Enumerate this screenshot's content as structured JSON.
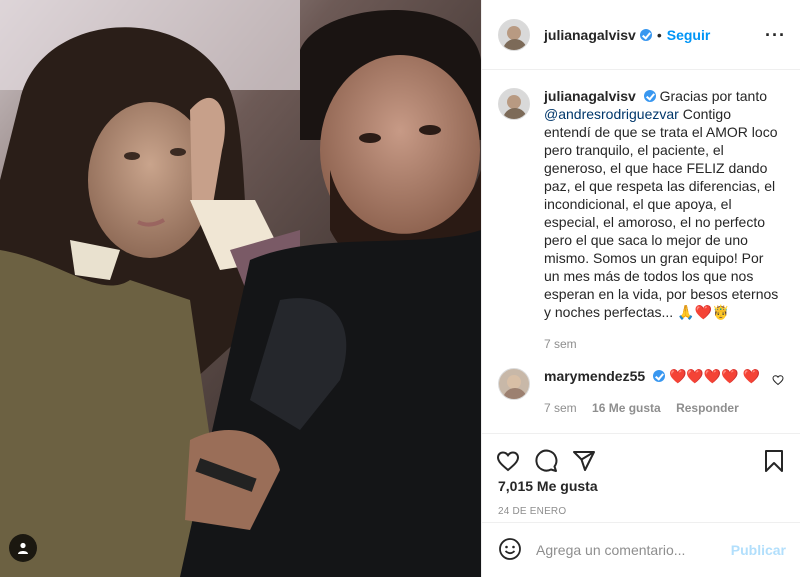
{
  "post": {
    "author": "julianagalvisv",
    "follow_label": "Seguir",
    "dot": "•",
    "more_icon": "more-horizontal-icon"
  },
  "caption": {
    "author": "julianagalvisv",
    "text_1": "Gracias por tanto",
    "mention": "@andresrodriguezvar",
    "text_2": "Contigo entendí de que se trata el AMOR loco pero tranquilo, el paciente, el generoso, el que hace FELIZ dando paz, el que respeta las diferencias, el incondicional, el que apoya, el especial, el amoroso, el no perfecto pero el que saca lo mejor de uno mismo. Somos un gran equipo! Por un mes más de todos los que nos esperan en la vida, por besos eternos y noches perfectas...",
    "emojis": "🙏❤️🤴",
    "time": "7 sem"
  },
  "comment": {
    "author": "marymendez55",
    "hearts": "❤️❤️❤️❤️ ❤️",
    "time": "7 sem",
    "likes": "16 Me gusta",
    "reply": "Responder"
  },
  "actions": {
    "likes": "7,015 Me gusta",
    "date": "24 DE ENERO",
    "icons": [
      "heart-icon",
      "comment-icon",
      "share-icon",
      "bookmark-icon"
    ]
  },
  "add_comment": {
    "placeholder": "Agrega un comentario...",
    "publish_label": "Publicar"
  },
  "colors": {
    "link_blue": "#0095f6",
    "verified": "#3897f0",
    "heart_red": "#ed4956",
    "muted": "#8e8e8e"
  }
}
